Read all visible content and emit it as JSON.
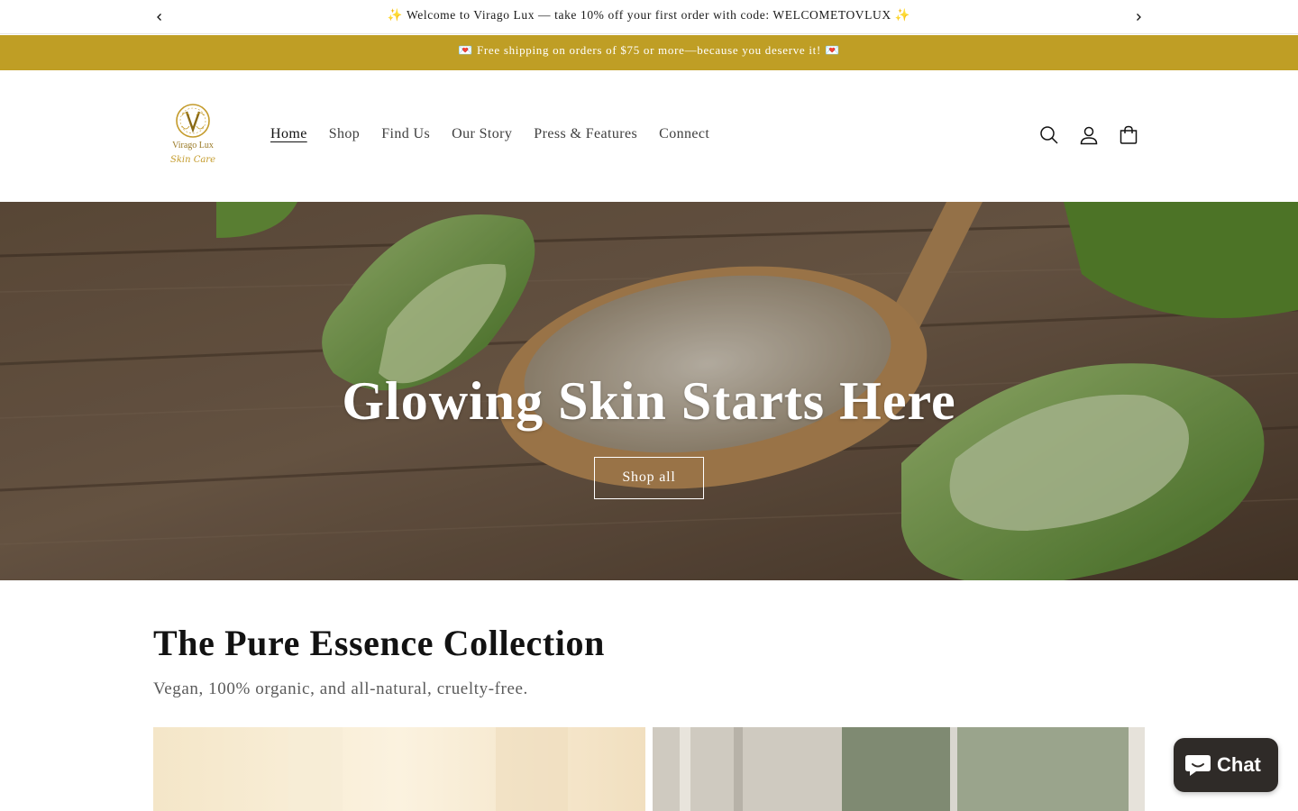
{
  "announcement": {
    "text": "✨ Welcome to Virago Lux — take 10% off your first order with code: WELCOMETOVLUX ✨",
    "prev_icon": "chevron-left-icon",
    "next_icon": "chevron-right-icon"
  },
  "shipping_bar": {
    "text": "💌 Free shipping on orders of $75 or more—because you deserve it! 💌",
    "color": "#bf9e25"
  },
  "header": {
    "logo": {
      "brand": "Virago Lux",
      "tagline": "Skin Care",
      "monogram": "V"
    },
    "nav": [
      {
        "label": "Home",
        "active": true
      },
      {
        "label": "Shop"
      },
      {
        "label": "Find Us"
      },
      {
        "label": "Our Story"
      },
      {
        "label": "Press & Features"
      },
      {
        "label": "Connect"
      }
    ],
    "icons": [
      "search-icon",
      "account-icon",
      "cart-icon"
    ]
  },
  "hero": {
    "title": "Glowing Skin Starts Here",
    "button_label": "Shop all"
  },
  "collection": {
    "title": "The Pure Essence Collection",
    "subtitle": "Vegan, 100% organic, and all-natural, cruelty-free."
  },
  "chat": {
    "label": "Chat",
    "icon": "chat-bubble-icon"
  }
}
